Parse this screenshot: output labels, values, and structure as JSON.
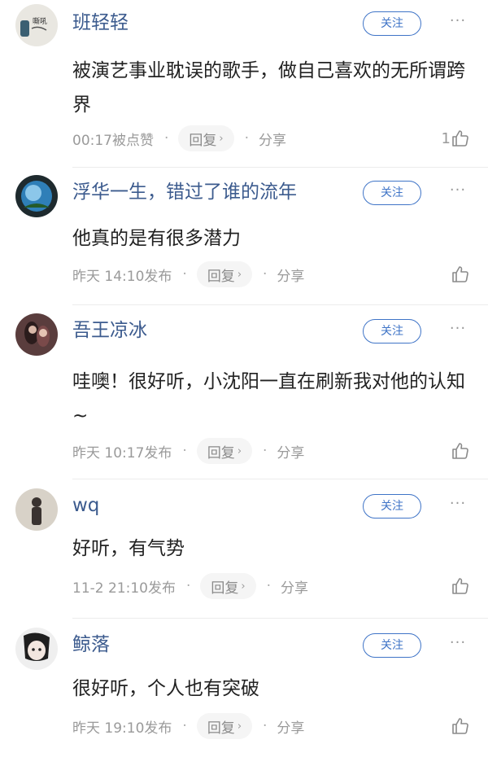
{
  "comments": [
    {
      "name": "班轻轻",
      "text": "被演艺事业耽误的歌手，做自己喜欢的无所谓跨界",
      "time": "00:17被点赞",
      "likes": "1",
      "avatar_text": "嘶吼"
    },
    {
      "name": "浮华一生，错过了谁的流年",
      "text": "他真的是有很多潜力",
      "time": "昨天 14:10发布",
      "likes": ""
    },
    {
      "name": "吾王凉冰",
      "text": "哇噢！很好听，小沈阳一直在刷新我对他的认知~",
      "time": "昨天 10:17发布",
      "likes": ""
    },
    {
      "name": "wq",
      "text": "好听，有气势",
      "time": "11-2 21:10发布",
      "likes": ""
    },
    {
      "name": "鲸落",
      "text": "很好听，个人也有突破",
      "time": "昨天 19:10发布",
      "likes": ""
    }
  ],
  "labels": {
    "follow": "关注",
    "reply": "回复",
    "share": "分享",
    "more": "···",
    "dot": "·",
    "reply_chevron": "›"
  },
  "colors": {
    "name": "#3c5b8e",
    "follow": "#3f74c7",
    "meta": "#9a9a9a"
  },
  "icons": {
    "like": "thumbs-up-icon",
    "more": "more-dots-icon",
    "reply_arrow": "chevron-right-icon"
  }
}
